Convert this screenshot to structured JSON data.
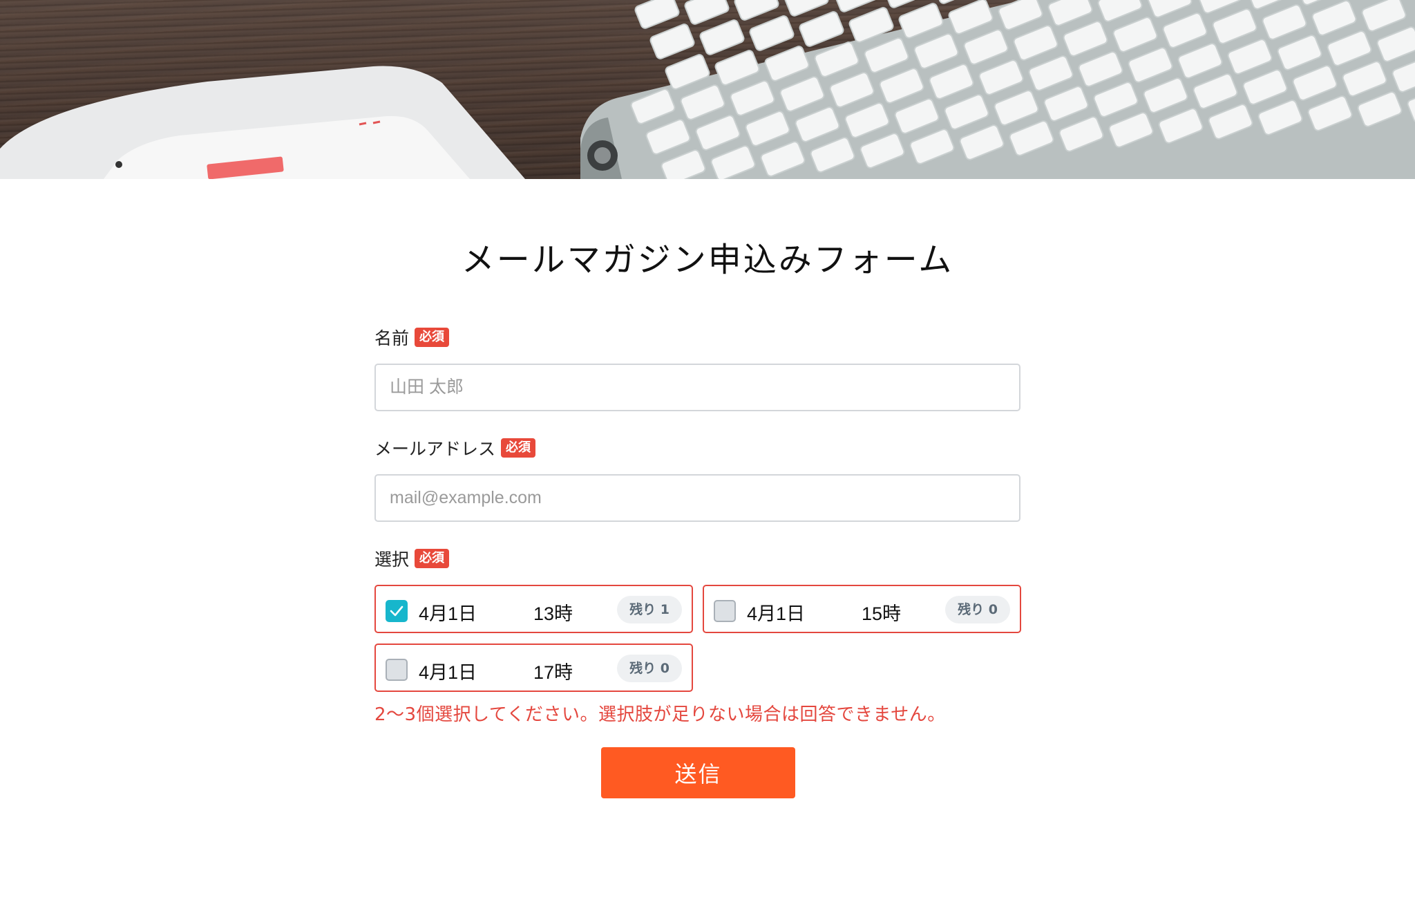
{
  "form": {
    "title": "メールマガジン申込みフォーム",
    "required_badge": "必須",
    "name_field": {
      "label": "名前",
      "placeholder": "山田 太郎",
      "value": ""
    },
    "email_field": {
      "label": "メールアドレス",
      "placeholder": "mail@example.com",
      "value": ""
    },
    "choice_field": {
      "label": "選択",
      "options": [
        {
          "date": "4月1日",
          "time": "13時",
          "remaining": "残り 1",
          "checked": true
        },
        {
          "date": "4月1日",
          "time": "15時",
          "remaining": "残り 0",
          "checked": false
        },
        {
          "date": "4月1日",
          "time": "17時",
          "remaining": "残り 0",
          "checked": false
        }
      ],
      "error": "2〜3個選択してください。選択肢が足りない場合は回答できません。"
    },
    "submit_label": "送信"
  },
  "colors": {
    "required_badge": "#e8493a",
    "error": "#e4473e",
    "checkbox_checked": "#17b6cc",
    "submit": "#ff5a22"
  },
  "hero": {
    "icon": "desk-keyboard-tablet-photo"
  }
}
